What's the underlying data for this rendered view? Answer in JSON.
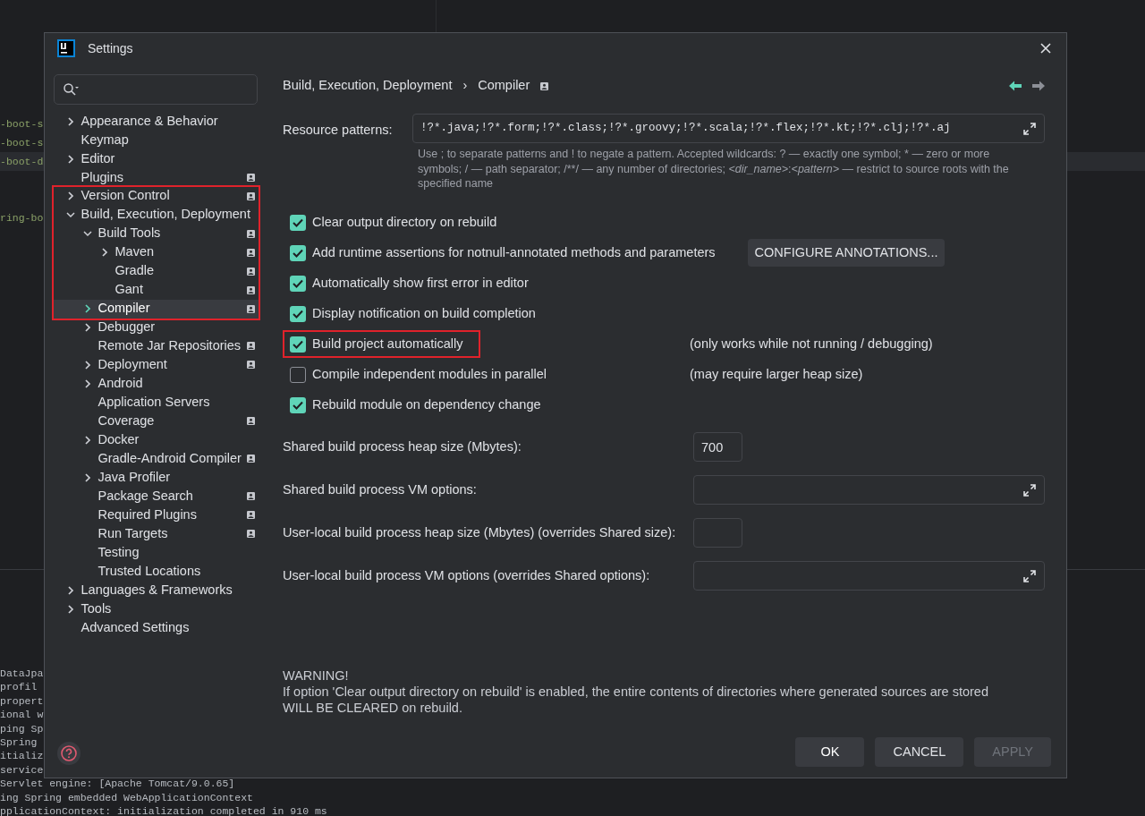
{
  "background": {
    "editor_lines": [
      {
        "text": "-boot-s",
        "highlighted": false
      },
      {
        "text": "-boot-s",
        "highlighted": false
      },
      {
        "text": "-boot-d",
        "highlighted": true
      },
      {
        "highlighted": false
      },
      {
        "highlighted": false
      },
      {
        "text": "ring-bo",
        "highlighted": false
      }
    ],
    "console_lines": [
      "DataJpa",
      "profil",
      "propert",
      "ional w",
      "ping Sp",
      "Spring",
      "itializ",
      "service"
    ],
    "console_tail": [
      "Servlet engine: [Apache Tomcat/9.0.65]",
      "ing Spring embedded WebApplicationContext",
      "pplicationContext: initialization completed in 910 ms"
    ]
  },
  "window": {
    "title": "Settings"
  },
  "tree": [
    {
      "label": "Appearance & Behavior",
      "kind": "branch",
      "expanded": false,
      "project_scoped": false,
      "selected": false,
      "marked": false
    },
    {
      "label": "Keymap",
      "kind": "leaf",
      "project_scoped": false,
      "selected": false,
      "marked": false
    },
    {
      "label": "Editor",
      "kind": "branch",
      "expanded": false,
      "project_scoped": false,
      "selected": false,
      "marked": false
    },
    {
      "label": "Plugins",
      "kind": "leaf",
      "project_scoped": true,
      "selected": false,
      "marked": false
    },
    {
      "label": "Version Control",
      "kind": "branch",
      "expanded": false,
      "project_scoped": true,
      "selected": false,
      "marked": true
    },
    {
      "label": "Build, Execution, Deployment",
      "kind": "branch",
      "expanded": true,
      "project_scoped": false,
      "selected": false,
      "marked": true,
      "children": [
        {
          "label": "Build Tools",
          "kind": "branch",
          "expanded": true,
          "project_scoped": true,
          "selected": false,
          "marked": true,
          "children": [
            {
              "label": "Maven",
              "kind": "branch",
              "expanded": false,
              "project_scoped": true,
              "selected": false,
              "marked": true
            },
            {
              "label": "Gradle",
              "kind": "leaf",
              "project_scoped": true,
              "selected": false,
              "marked": true
            },
            {
              "label": "Gant",
              "kind": "leaf",
              "project_scoped": true,
              "selected": false,
              "marked": true
            }
          ]
        },
        {
          "label": "Compiler",
          "kind": "branch",
          "expanded": false,
          "project_scoped": true,
          "selected": true,
          "marked": true
        },
        {
          "label": "Debugger",
          "kind": "branch",
          "expanded": false,
          "project_scoped": false,
          "selected": false,
          "marked": false
        },
        {
          "label": "Remote Jar Repositories",
          "kind": "leaf",
          "project_scoped": true,
          "selected": false,
          "marked": false
        },
        {
          "label": "Deployment",
          "kind": "branch",
          "expanded": false,
          "project_scoped": true,
          "selected": false,
          "marked": false
        },
        {
          "label": "Android",
          "kind": "branch",
          "expanded": false,
          "project_scoped": false,
          "selected": false,
          "marked": false
        },
        {
          "label": "Application Servers",
          "kind": "leaf",
          "project_scoped": false,
          "selected": false,
          "marked": false
        },
        {
          "label": "Coverage",
          "kind": "leaf",
          "project_scoped": true,
          "selected": false,
          "marked": false
        },
        {
          "label": "Docker",
          "kind": "branch",
          "expanded": false,
          "project_scoped": false,
          "selected": false,
          "marked": false
        },
        {
          "label": "Gradle-Android Compiler",
          "kind": "leaf",
          "project_scoped": true,
          "selected": false,
          "marked": false
        },
        {
          "label": "Java Profiler",
          "kind": "branch",
          "expanded": false,
          "project_scoped": false,
          "selected": false,
          "marked": false
        },
        {
          "label": "Package Search",
          "kind": "leaf",
          "project_scoped": true,
          "selected": false,
          "marked": false
        },
        {
          "label": "Required Plugins",
          "kind": "leaf",
          "project_scoped": true,
          "selected": false,
          "marked": false
        },
        {
          "label": "Run Targets",
          "kind": "leaf",
          "project_scoped": true,
          "selected": false,
          "marked": false
        },
        {
          "label": "Testing",
          "kind": "leaf",
          "project_scoped": false,
          "selected": false,
          "marked": false
        },
        {
          "label": "Trusted Locations",
          "kind": "leaf",
          "project_scoped": false,
          "selected": false,
          "marked": false
        }
      ]
    },
    {
      "label": "Languages & Frameworks",
      "kind": "branch",
      "expanded": false,
      "project_scoped": false,
      "selected": false,
      "marked": false
    },
    {
      "label": "Tools",
      "kind": "branch",
      "expanded": false,
      "project_scoped": false,
      "selected": false,
      "marked": false
    },
    {
      "label": "Advanced Settings",
      "kind": "leaf",
      "project_scoped": false,
      "selected": false,
      "marked": false
    }
  ],
  "breadcrumb": {
    "items": [
      "Build, Execution, Deployment",
      "Compiler"
    ],
    "separator": "›",
    "project_scoped": true
  },
  "navigation": {
    "back_enabled": true,
    "forward_enabled": false
  },
  "resource_patterns": {
    "label": "Resource patterns:",
    "value": "!?*.java;!?*.form;!?*.class;!?*.groovy;!?*.scala;!?*.flex;!?*.kt;!?*.clj;!?*.aj",
    "help": "Use ; to separate patterns and ! to negate a pattern. Accepted wildcards: ? — exactly one symbol; * — zero or more symbols; / — path separator; /**/ — any number of directories; *<dir_name>*:*<pattern>* — restrict to source roots with the specified name"
  },
  "options": [
    {
      "label": "Clear output directory on rebuild",
      "checked": true,
      "marked": false
    },
    {
      "label": "Add runtime assertions for notnull-annotated methods and parameters",
      "checked": true,
      "marked": false,
      "button": "CONFIGURE ANNOTATIONS..."
    },
    {
      "label": "Automatically show first error in editor",
      "checked": true,
      "marked": false
    },
    {
      "label": "Display notification on build completion",
      "checked": true,
      "marked": false
    },
    {
      "label": "Build project automatically",
      "checked": true,
      "marked": true,
      "note": "(only works while not running / debugging)"
    },
    {
      "label": "Compile independent modules in parallel",
      "checked": false,
      "marked": false,
      "note": "(may require larger heap size)"
    },
    {
      "label": "Rebuild module on dependency change",
      "checked": true,
      "marked": false
    }
  ],
  "fields": [
    {
      "label": "Shared build process heap size (Mbytes):",
      "kind": "short",
      "value": "700"
    },
    {
      "label": "Shared build process VM options:",
      "kind": "expandable"
    },
    {
      "label": "User-local build process heap size (Mbytes) (overrides Shared size):",
      "kind": "short"
    },
    {
      "label": "User-local build process VM options (overrides Shared options):",
      "kind": "expandable"
    }
  ],
  "warning": {
    "title": "WARNING!",
    "text": "If option 'Clear output directory on rebuild' is enabled, the entire contents of directories where generated sources are stored WILL BE CLEARED on rebuild."
  },
  "buttons": [
    {
      "label": "OK",
      "disabled": false,
      "default": true
    },
    {
      "label": "CANCEL",
      "disabled": false,
      "default": false
    },
    {
      "label": "APPLY",
      "disabled": true,
      "default": false
    }
  ]
}
